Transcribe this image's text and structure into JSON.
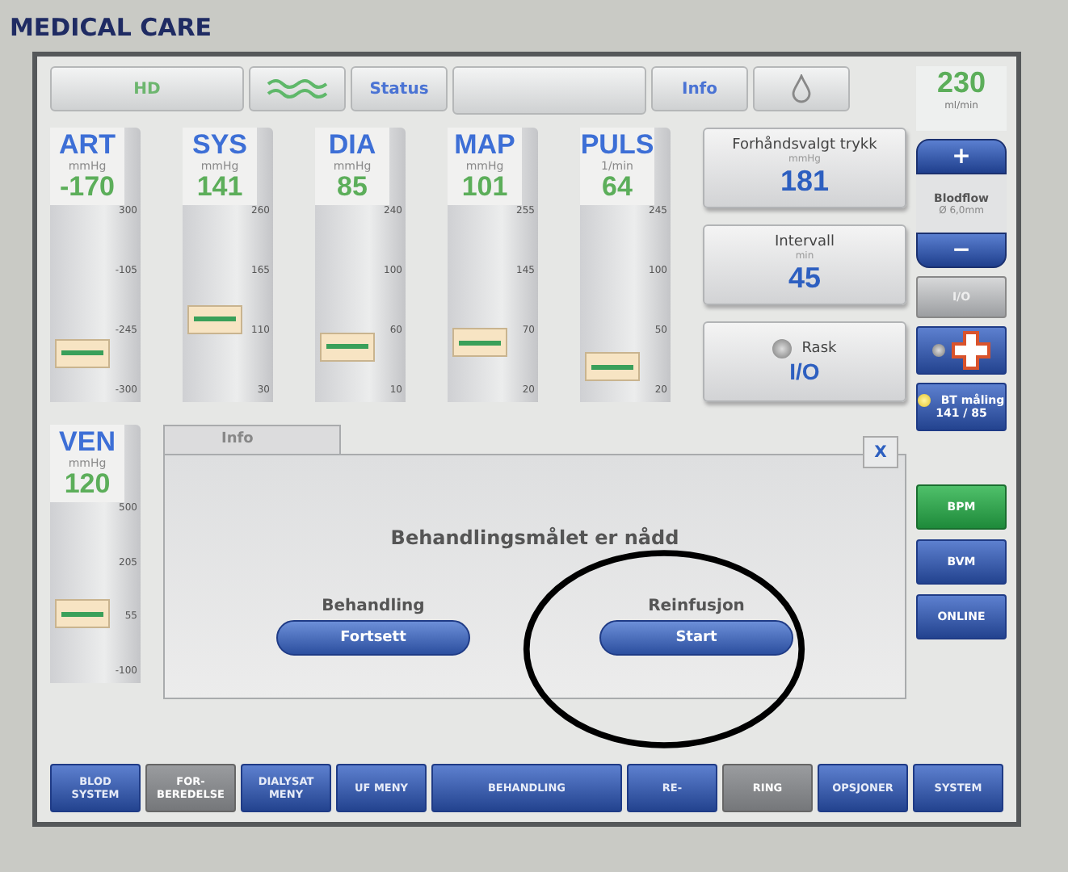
{
  "brand": "MEDICAL CARE",
  "top_bar": [
    {
      "kind": "text",
      "label": "HD",
      "color": "#6db66f"
    },
    {
      "kind": "waves"
    },
    {
      "kind": "text",
      "label": "Status",
      "color": "#4a73d4"
    },
    {
      "kind": "blank"
    },
    {
      "kind": "text",
      "label": "Info",
      "color": "#4a73d4"
    },
    {
      "kind": "drop"
    }
  ],
  "flow_display": {
    "value": "230",
    "unit": "ml/min"
  },
  "gauges": [
    {
      "label": "ART",
      "unit": "mmHg",
      "value": "-170",
      "ticks": [
        "300",
        "-105",
        "-245",
        "-300"
      ],
      "level": 0.25
    },
    {
      "label": "SYS",
      "unit": "mmHg",
      "value": "141",
      "ticks": [
        "260",
        "165",
        "110",
        "30"
      ],
      "level": 0.42
    },
    {
      "label": "DIA",
      "unit": "mmHg",
      "value": "85",
      "ticks": [
        "240",
        "100",
        "60",
        "10"
      ],
      "level": 0.28
    },
    {
      "label": "MAP",
      "unit": "mmHg",
      "value": "101",
      "ticks": [
        "255",
        "145",
        "70",
        "20"
      ],
      "level": 0.3
    },
    {
      "label": "PULS",
      "unit": "1/min",
      "value": "64",
      "ticks": [
        "245",
        "100",
        "50",
        "20"
      ],
      "level": 0.18
    }
  ],
  "ven_gauge": {
    "label": "VEN",
    "unit": "mmHg",
    "value": "120",
    "ticks": [
      "500",
      "205",
      "55",
      "-100"
    ],
    "level": 0.38
  },
  "settings": [
    {
      "kind": "value",
      "label": "Forhåndsvalgt trykk",
      "unit": "mmHg",
      "value": "181"
    },
    {
      "kind": "value",
      "label": "Intervall",
      "unit": "min",
      "value": "45"
    },
    {
      "kind": "toggle",
      "label": "Rask",
      "value": "I/O",
      "on": false
    }
  ],
  "blood_pump": {
    "plus": "+",
    "label": "Blodflow",
    "sub": "Ø 6,0mm",
    "minus": "−"
  },
  "side_buttons": [
    {
      "kind": "text",
      "label": "I/O",
      "disabled": true
    },
    {
      "kind": "cross",
      "on": false
    },
    {
      "kind": "led",
      "label": "BT måling",
      "value": "141 / 85",
      "on": true
    }
  ],
  "mode_buttons": [
    {
      "label": "BPM",
      "selected": true
    },
    {
      "label": "BVM",
      "selected": false
    },
    {
      "label": "ONLINE",
      "selected": false
    }
  ],
  "dialog": {
    "tab": "Info",
    "close": "X",
    "message": "Behandlingsmålet er nådd",
    "actions": [
      {
        "caption": "Behandling",
        "button": "Fortsett"
      },
      {
        "caption": "Reinfusjon",
        "button": "Start"
      }
    ]
  },
  "nav": [
    {
      "label": "BLOD SYSTEM",
      "disabled": false
    },
    {
      "label": "FOR- BEREDELSE",
      "disabled": true
    },
    {
      "label": "DIALYSAT MENY",
      "disabled": false
    },
    {
      "label": "UF MENY",
      "disabled": false
    },
    {
      "label": "BEHANDLING",
      "disabled": false
    },
    {
      "label": "RE-",
      "disabled": false
    },
    {
      "label": "RING",
      "disabled": true
    },
    {
      "label": "OPSJONER",
      "disabled": false
    },
    {
      "label": "SYSTEM",
      "disabled": false
    }
  ]
}
